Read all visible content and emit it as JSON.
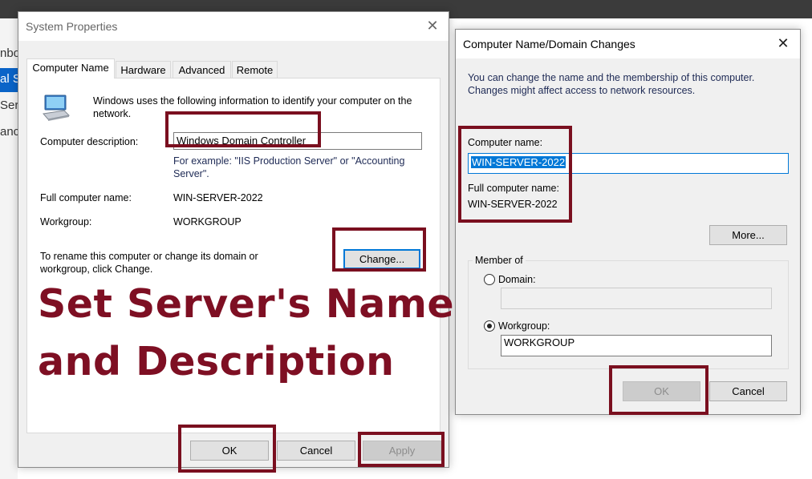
{
  "system_properties": {
    "title": "System Properties",
    "tabs": [
      "Computer Name",
      "Hardware",
      "Advanced",
      "Remote"
    ],
    "intro": "Windows uses the following information to identify your computer on the network.",
    "description_label": "Computer description:",
    "description_value": "Windows Domain Controller",
    "example_text": "For example: \"IIS Production Server\" or \"Accounting Server\".",
    "full_name_label": "Full computer name:",
    "full_name_value": "WIN-SERVER-2022",
    "workgroup_label": "Workgroup:",
    "workgroup_value": "WORKGROUP",
    "rename_text": "To rename this computer or change its domain or workgroup, click Change.",
    "change_button": "Change...",
    "ok_button": "OK",
    "cancel_button": "Cancel",
    "apply_button": "Apply"
  },
  "domain_changes": {
    "title": "Computer Name/Domain Changes",
    "intro": "You can change the name and the membership of this computer. Changes might affect access to network resources.",
    "computer_name_label": "Computer name:",
    "computer_name_value": "WIN-SERVER-2022",
    "full_name_label": "Full computer name:",
    "full_name_value": "WIN-SERVER-2022",
    "more_button": "More...",
    "member_of_label": "Member of",
    "domain_label": "Domain:",
    "domain_value": "",
    "workgroup_label": "Workgroup:",
    "workgroup_value": "WORKGROUP",
    "selected_membership": "Workgroup",
    "ok_button": "OK",
    "cancel_button": "Cancel"
  },
  "overlay": {
    "line1": "Set Server's Name",
    "line2": "and Description"
  },
  "background": {
    "frag1": "nbo",
    "frag2": "al S",
    "frag3": "Serv",
    "frag4": "anc"
  },
  "colors": {
    "highlight_red": "#7a0f1f",
    "accent_blue": "#0078d7"
  },
  "icons": {
    "computer": "computer-icon",
    "close": "close-icon"
  }
}
